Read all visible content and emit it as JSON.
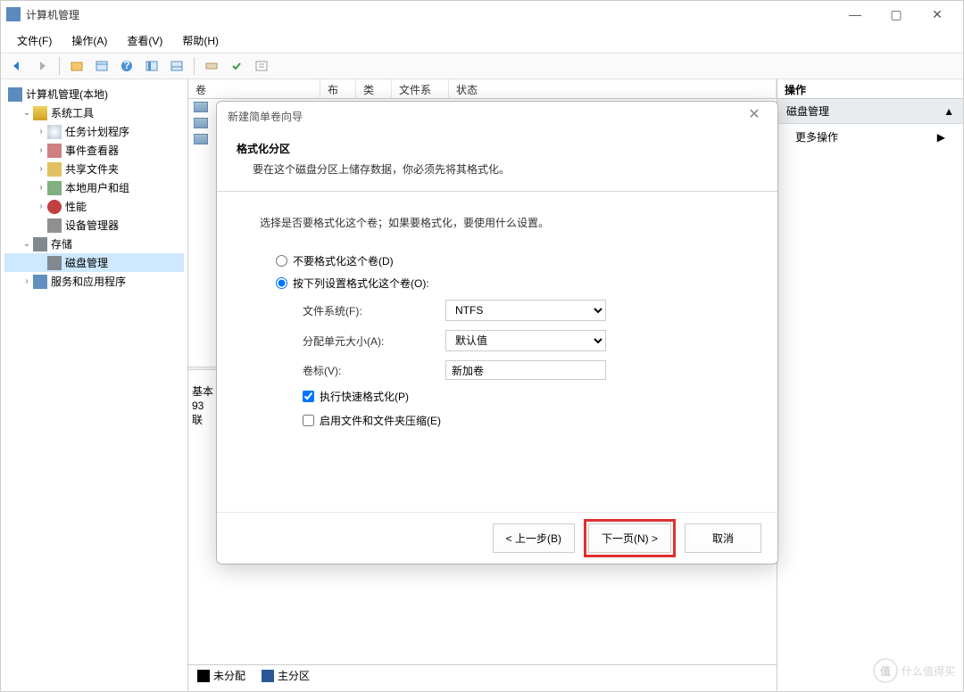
{
  "window": {
    "title": "计算机管理",
    "minimize": "—",
    "maximize": "▢",
    "close": "✕"
  },
  "menu": {
    "file": "文件(F)",
    "action": "操作(A)",
    "view": "查看(V)",
    "help": "帮助(H)"
  },
  "tree": {
    "root": "计算机管理(本地)",
    "systools": "系统工具",
    "scheduler": "任务计划程序",
    "eventviewer": "事件查看器",
    "shared": "共享文件夹",
    "localusers": "本地用户和组",
    "perf": "性能",
    "devmgr": "设备管理器",
    "storage": "存储",
    "diskmgmt": "磁盘管理",
    "services": "服务和应用程序"
  },
  "grid": {
    "col_volume": "卷",
    "col_layout": "布局",
    "col_type": "类型",
    "col_fs": "文件系统",
    "col_status": "状态"
  },
  "lower": {
    "disk_kind": "基本",
    "disk_size": "93",
    "status_partial": "联",
    "legend_unalloc": "未分配",
    "legend_primary": "主分区"
  },
  "actions": {
    "header": "操作",
    "diskmgmt": "磁盘管理",
    "more": "更多操作",
    "arrow_up": "▲",
    "arrow_right": "▶"
  },
  "dialog": {
    "title": "新建简单卷向导",
    "close": "✕",
    "heading": "格式化分区",
    "subheading": "要在这个磁盘分区上储存数据，你必须先将其格式化。",
    "instruction": "选择是否要格式化这个卷；如果要格式化，要使用什么设置。",
    "radio_noformat": "不要格式化这个卷(D)",
    "radio_format": "按下列设置格式化这个卷(O):",
    "lbl_fs": "文件系统(F):",
    "val_fs": "NTFS",
    "lbl_alloc": "分配单元大小(A):",
    "val_alloc": "默认值",
    "lbl_label": "卷标(V):",
    "val_label": "新加卷",
    "chk_quick": "执行快速格式化(P)",
    "chk_compress": "启用文件和文件夹压缩(E)",
    "btn_back": "< 上一步(B)",
    "btn_next": "下一页(N) >",
    "btn_cancel": "取消"
  },
  "watermark": {
    "badge": "值",
    "text": "什么值得买"
  }
}
